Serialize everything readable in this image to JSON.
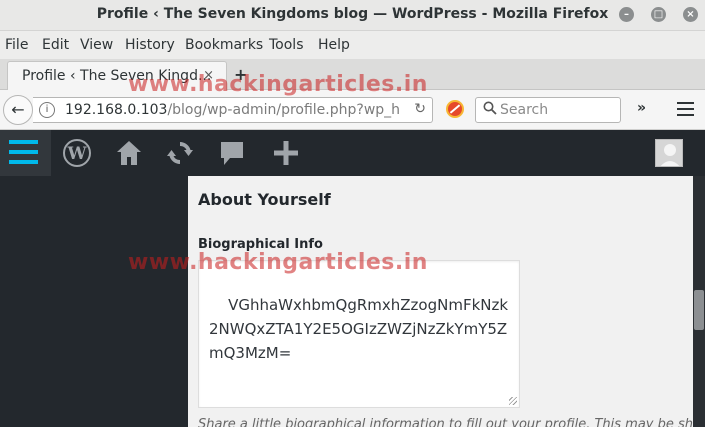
{
  "window": {
    "title": "Profile ‹ The Seven Kingdoms blog — WordPress - Mozilla Firefox",
    "minimize_glyph": "–",
    "maximize_glyph": "□",
    "close_glyph": "×"
  },
  "menubar": {
    "items": [
      "File",
      "Edit",
      "View",
      "History",
      "Bookmarks",
      "Tools",
      "Help"
    ]
  },
  "tabs": {
    "active_label": "Profile ‹ The Seven Kingd...",
    "close_glyph": "×",
    "new_tab_glyph": "+"
  },
  "navbar": {
    "back_glyph": "←",
    "info_glyph": "i",
    "url_host": "192.168.0.103",
    "url_path": "/blog/wp-admin/profile.php?wp_h",
    "reload_glyph": "↻",
    "search_placeholder": "Search",
    "search_glyph": "🔍",
    "overflow_glyph": "»"
  },
  "icons": {
    "menu": "menu-icon",
    "wordpress": "wordpress-logo-icon",
    "home": "home-icon",
    "updates": "updates-icon",
    "comments": "comments-icon",
    "new": "plus-icon",
    "avatar": "avatar-icon"
  },
  "colors": {
    "wp_admin_bar": "#23282d",
    "wp_accent": "#00b9eb",
    "content_bg": "#f1f1f1",
    "watermark": "#c81e1e"
  },
  "profile": {
    "section_title": "About Yourself",
    "bio_label": "Biographical Info",
    "bio_value": "VGhhaWxhbmQgRmxhZzogNmFkNzk2NWQxZTA1Y2E5OGIzZWZjNzZkYmY5ZmQ3MzM=",
    "bio_help": "Share a little biographical information to fill out your profile. This may be shown pub"
  },
  "watermark": {
    "text": "www.hackingarticles.in"
  }
}
